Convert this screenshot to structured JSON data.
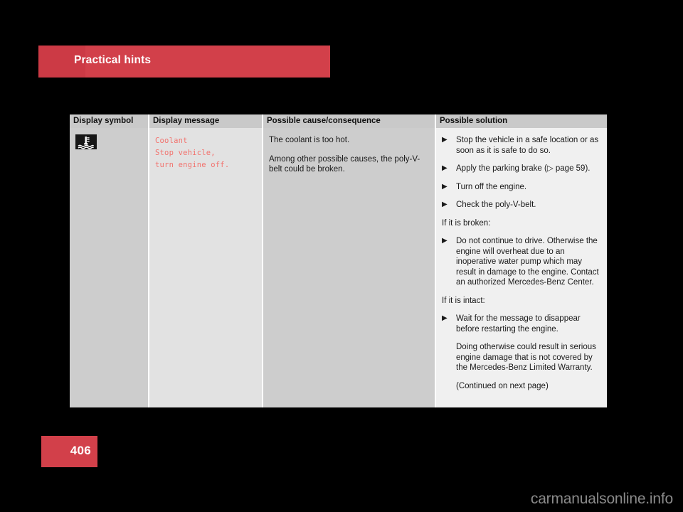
{
  "chapter": {
    "title": "Practical hints"
  },
  "page": {
    "number": "406",
    "watermark": "carmanualsonline.info"
  },
  "colors": {
    "brand_red": "#d2404a",
    "brand_red_dark": "#cc3a45",
    "display_message_red": "#f2736e",
    "table_header_gray": "#c9c9c9",
    "col1_gray": "#cdcdcd",
    "col2_gray": "#e2e2e2",
    "col3_gray": "#cdcdcd",
    "col4_gray": "#f0f0f0"
  },
  "table": {
    "headers": [
      "Display symbol",
      "Display message",
      "Possible cause/consequence",
      "Possible solution"
    ],
    "row": {
      "symbol": {
        "icon_name": "coolant-temperature-warning-icon",
        "description": "Coolant temperature warning symbol"
      },
      "display_message": [
        "Coolant",
        "Stop vehicle,",
        "turn engine off."
      ],
      "cause": [
        "The coolant is too hot.",
        "Among other possible causes, the poly-V-belt could be broken."
      ],
      "solution": {
        "bullets_primary": [
          "Stop the vehicle in a safe location or as soon as it is safe to do so.",
          "Apply the parking brake (▷ page 59).",
          "Turn off the engine.",
          "Check the poly-V-belt."
        ],
        "broken_heading": "If it is broken:",
        "broken_bullet": "Do not continue to drive. Otherwise the engine will overheat due to an inoperative water pump which may result in damage to the engine. Contact an authorized Mercedes-Benz Center.",
        "intact_heading": "If it is intact:",
        "intact_bullet": "Wait for the message to disappear before restarting the engine.",
        "intact_note": "Doing otherwise could result in serious engine damage that is not covered by the Mercedes-Benz Limited Warranty.",
        "continued": "(Continued on next page)",
        "bullet_glyph": "▶"
      }
    }
  }
}
